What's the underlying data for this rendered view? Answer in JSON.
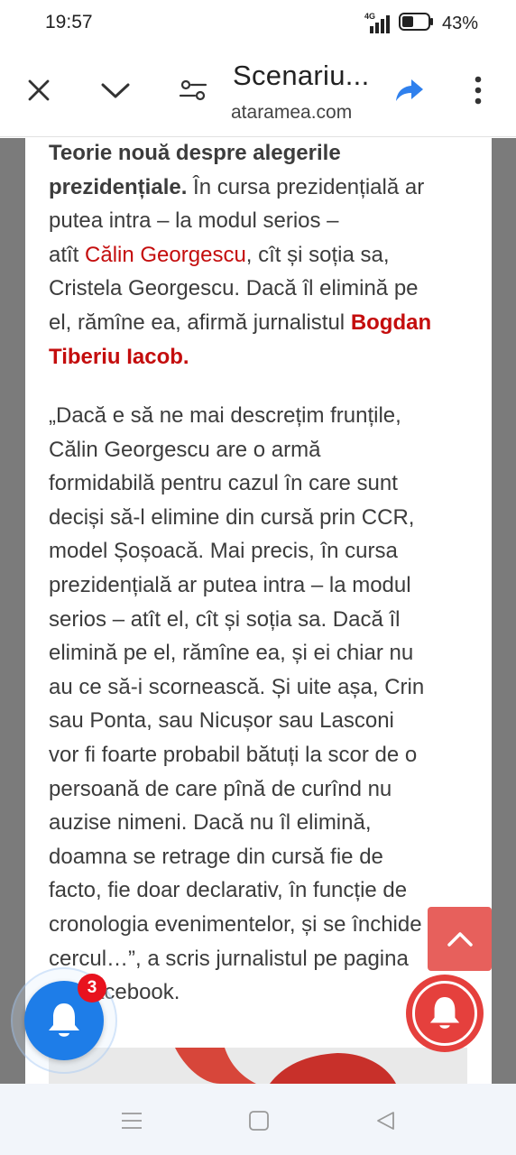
{
  "status_bar": {
    "time": "19:57",
    "network": "4G",
    "battery_percent": "43%",
    "battery_level": 0.43
  },
  "toolbar": {
    "title": "Scenariu...",
    "domain": "ataramea.com",
    "icons": [
      "close-icon",
      "chevron-down-icon",
      "page-info-icon",
      "share-icon",
      "more-vert-icon"
    ],
    "share_color": "#2f80ed"
  },
  "article": {
    "p1": {
      "bold_1": "Teorie nouă despre alegerile",
      "bold_2": "prezidențiale.",
      "text_1": " În cursa prezidențială ar",
      "text_2": "putea intra – la modul serios –",
      "text_3": "atît ",
      "link_1": "Călin Georgescu",
      "text_4": ", cît și soția sa,",
      "text_5": "Cristela Georgescu. Dacă îl elimină pe",
      "text_6": "el, rămîne ea, afirmă jurnalistul ",
      "link_2a": "Bogdan",
      "link_2b": "Tiberiu Iacob."
    },
    "p2_lines": [
      "„Dacă e să ne mai descrețim frunțile,",
      "Călin Georgescu are o armă",
      "formidabilă pentru cazul în care sunt",
      "deciși să-l elimine din cursă prin CCR,",
      "model Șoșoacă. Mai precis, în cursa",
      "prezidențială ar putea intra – la modul",
      "serios – atît el, cît și soția sa. Dacă îl",
      "elimină pe el, rămîne ea, și ei chiar nu",
      "au ce să-i scornească. Și uite așa, Crin",
      "sau Ponta, sau Nicușor sau Lasconi",
      "vor fi foarte probabil bătuți la scor de o",
      "persoană de care pînă de curînd nu",
      "auzise nimeni. Dacă nu îl elimină,",
      "doamna se retrage din cursă fie de",
      "facto, fie doar declarativ, în funcție de",
      "cronologia evenimentelor, și se închide",
      "cercul…”, a scris jurnalistul pe pagina",
      "de Facebook."
    ],
    "link_color": "#c40d0d"
  },
  "floating": {
    "notification_badge": "3",
    "scroll_top_icon": "chevron-up-icon",
    "bell_left_color": "#1e7de8",
    "bell_right_color": "#e5403d"
  },
  "navbar": {
    "icons": [
      "menu-icon",
      "home-square-icon",
      "back-triangle-icon"
    ]
  }
}
